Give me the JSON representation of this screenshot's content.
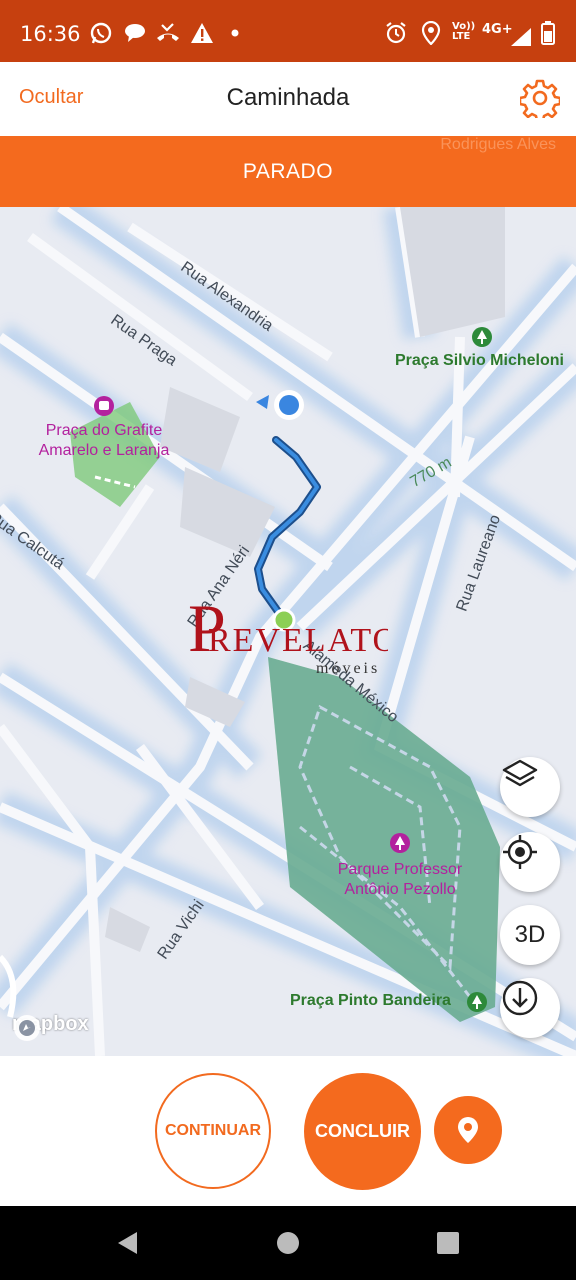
{
  "status_bar": {
    "time": "16:36",
    "volte": "Vo)) LTE",
    "network": "4G+",
    "icons": [
      "whatsapp-icon",
      "chat-bubble-icon",
      "missed-call-icon",
      "warning-icon",
      "dot-icon",
      "alarm-icon",
      "location-icon",
      "signal-icon",
      "battery-icon"
    ]
  },
  "header": {
    "hide_label": "Ocultar",
    "title": "Caminhada",
    "settings_icon": "gear-icon"
  },
  "banner": {
    "status": "PARADO",
    "street_faded": "Rodrigues Alves"
  },
  "map": {
    "streets": [
      "Rua Alexandria",
      "Rua Praga",
      "Rua Calcutá",
      "Rua Ana Néri",
      "Alameda México",
      "Rua Laureano",
      "Rua Vichi"
    ],
    "distance_label": "770 m",
    "pois": [
      {
        "name_line1": "Praça do Grafite",
        "name_line2": "Amarelo e Laranja"
      },
      {
        "name_line1": "Parque Professor",
        "name_line2": "Antônio Pezollo"
      }
    ],
    "parks": [
      "Praça Silvio Micheloni",
      "Praça Pinto Bandeira"
    ],
    "attribution": "mapbox",
    "controls": {
      "layers_icon": "layers-icon",
      "locate_icon": "crosshair-icon",
      "btn_3d": "3D",
      "download_icon": "download-icon"
    },
    "colors": {
      "route": "#2f74c0",
      "user_dot": "#3a86e0",
      "start_dot": "#8ccf55",
      "park": "#7ec97a"
    }
  },
  "watermark": {
    "main": "REVELATO",
    "sub": "móveis",
    "letter": "P"
  },
  "actions": {
    "continue_label": "CONTINUAR",
    "finish_label": "CONCLUIR",
    "pin_icon": "map-pin-icon",
    "accent_color": "#f46a1e"
  },
  "nav": {
    "back_icon": "back-triangle-icon",
    "home_icon": "home-circle-icon",
    "recents_icon": "recents-square-icon"
  }
}
